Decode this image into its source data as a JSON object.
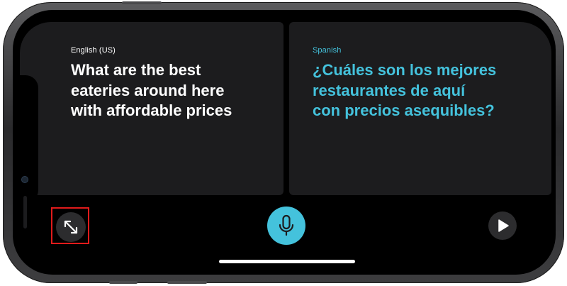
{
  "source_panel": {
    "language": "English (US)",
    "text": "What are the best\neateries around here\nwith affordable prices"
  },
  "target_panel": {
    "language": "Spanish",
    "text": "¿Cuáles son los mejores\nrestaurantes de aquí\ncon precios asequibles?"
  },
  "controls": {
    "expand": "expand-arrows-icon",
    "microphone": "microphone-icon",
    "play": "play-icon"
  },
  "colors": {
    "accent": "#44c2dc",
    "panel": "#1c1c1e",
    "highlight": "#e11b1b"
  }
}
